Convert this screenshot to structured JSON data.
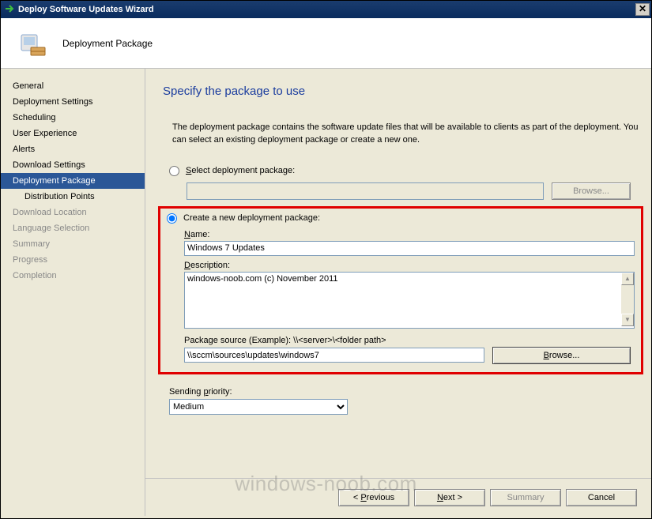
{
  "window": {
    "title": "Deploy Software Updates Wizard"
  },
  "banner": {
    "title": "Deployment Package"
  },
  "sidebar": {
    "items": [
      {
        "label": "General",
        "indented": false,
        "selected": false,
        "disabled": false
      },
      {
        "label": "Deployment Settings",
        "indented": false,
        "selected": false,
        "disabled": false
      },
      {
        "label": "Scheduling",
        "indented": false,
        "selected": false,
        "disabled": false
      },
      {
        "label": "User Experience",
        "indented": false,
        "selected": false,
        "disabled": false
      },
      {
        "label": "Alerts",
        "indented": false,
        "selected": false,
        "disabled": false
      },
      {
        "label": "Download Settings",
        "indented": false,
        "selected": false,
        "disabled": false
      },
      {
        "label": "Deployment Package",
        "indented": false,
        "selected": true,
        "disabled": false
      },
      {
        "label": "Distribution Points",
        "indented": true,
        "selected": false,
        "disabled": false
      },
      {
        "label": "Download Location",
        "indented": false,
        "selected": false,
        "disabled": true
      },
      {
        "label": "Language Selection",
        "indented": false,
        "selected": false,
        "disabled": true
      },
      {
        "label": "Summary",
        "indented": false,
        "selected": false,
        "disabled": true
      },
      {
        "label": "Progress",
        "indented": false,
        "selected": false,
        "disabled": true
      },
      {
        "label": "Completion",
        "indented": false,
        "selected": false,
        "disabled": true
      }
    ]
  },
  "main": {
    "heading": "Specify the package to use",
    "description": "The deployment package contains the software update files that will be available to clients as part of the deployment. You can select an existing deployment package or create a new one.",
    "radio_select_label": "Select deployment package:",
    "radio_create_label": "Create a new deployment package:",
    "browse_label": "Browse...",
    "name_label": "Name:",
    "name_value": "Windows 7 Updates",
    "desc_label": "Description:",
    "desc_value": "windows-noob.com (c) November 2011",
    "source_label": "Package source (Example): \\\\<server>\\<folder path>",
    "source_value": "\\\\sccm\\sources\\updates\\windows7",
    "priority_label": "Sending priority:",
    "priority_value": "Medium"
  },
  "footer": {
    "previous": "< Previous",
    "next": "Next >",
    "summary": "Summary",
    "cancel": "Cancel"
  },
  "watermark": "windows-noob.com"
}
